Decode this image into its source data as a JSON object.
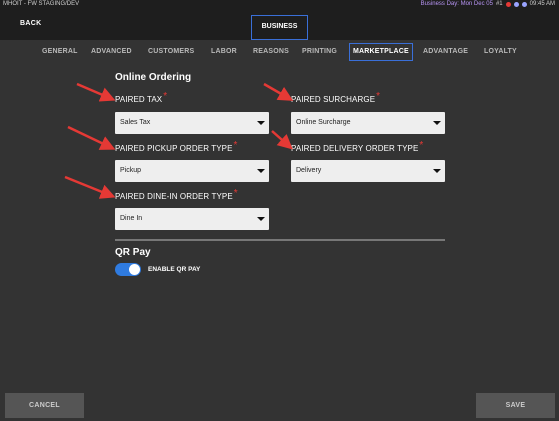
{
  "status_bar": {
    "left_text": "MHOIT - FW STAGING/DEV",
    "business_day": "Business Day: Mon Dec 05",
    "terminal": "#1",
    "time": "09:45 AM"
  },
  "header": {
    "back_label": "BACK",
    "business_tab": "BUSINESS"
  },
  "tabs": [
    {
      "label": "GENERAL"
    },
    {
      "label": "ADVANCED"
    },
    {
      "label": "CUSTOMERS"
    },
    {
      "label": "LABOR"
    },
    {
      "label": "REASONS"
    },
    {
      "label": "PRINTING"
    },
    {
      "label": "MARKETPLACE",
      "active": true
    },
    {
      "label": "ADVANTAGE"
    },
    {
      "label": "LOYALTY"
    }
  ],
  "online_ordering": {
    "title": "Online Ordering",
    "paired_tax": {
      "label": "PAIRED TAX",
      "required": "*",
      "value": "Sales Tax"
    },
    "paired_surcharge": {
      "label": "PAIRED SURCHARGE",
      "required": "*",
      "value": "Online Surcharge"
    },
    "paired_pickup": {
      "label": "PAIRED PICKUP ORDER TYPE",
      "required": "*",
      "value": "Pickup"
    },
    "paired_delivery": {
      "label": "PAIRED DELIVERY ORDER TYPE",
      "required": "*",
      "value": "Delivery"
    },
    "paired_dine_in": {
      "label": "PAIRED DINE-IN ORDER TYPE",
      "required": "*",
      "value": "Dine In"
    }
  },
  "qr_pay": {
    "title": "QR Pay",
    "toggle_label": "ENABLE QR PAY",
    "enabled": true
  },
  "footer": {
    "cancel_label": "CANCEL",
    "save_label": "SAVE"
  },
  "colors": {
    "background": "#333333",
    "header": "#1e1e1e",
    "accent": "#3a6fd8",
    "toggle": "#2f7be0",
    "required": "#e53935",
    "annotation_arrow": "#e53935"
  }
}
